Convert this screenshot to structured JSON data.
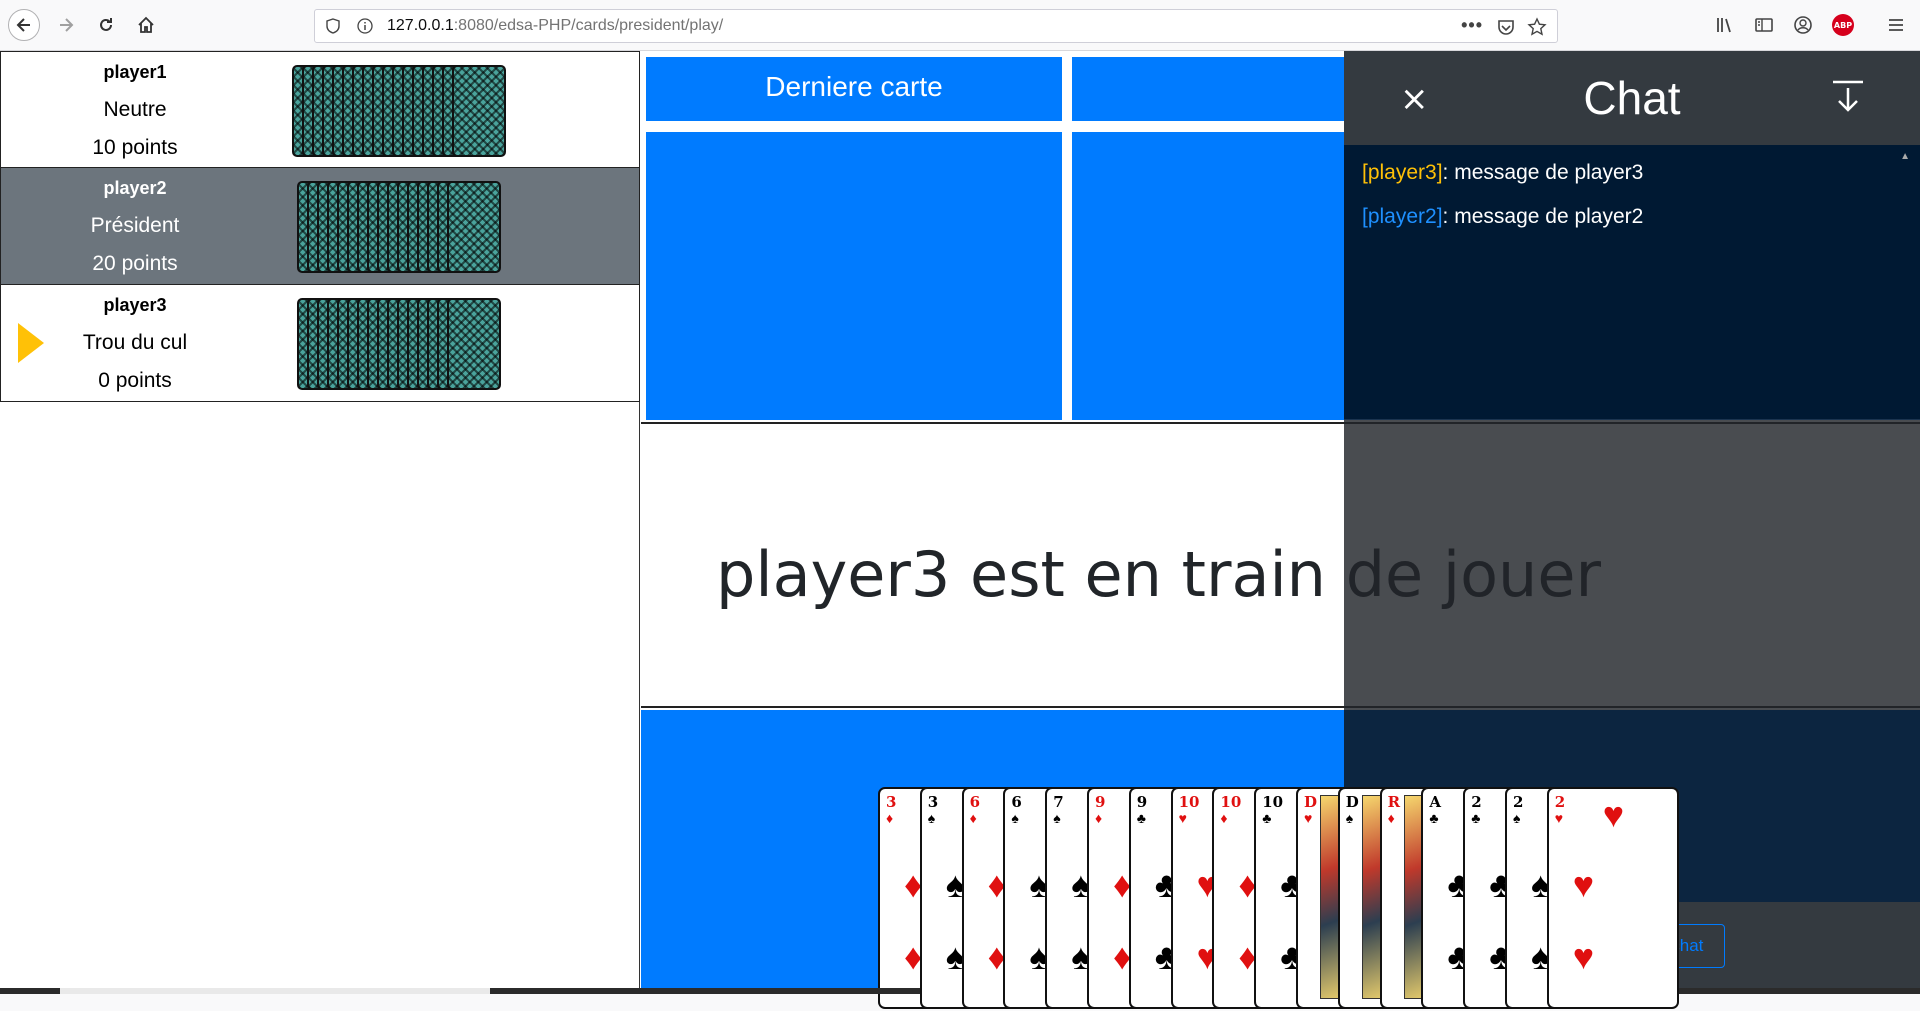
{
  "browser": {
    "url_host": "127.0.0.1",
    "url_rest": ":8080/edsa-PHP/cards/president/play/"
  },
  "players": [
    {
      "name": "player1",
      "rank": "Neutre",
      "points": "10 points",
      "cards": 17,
      "current": false,
      "highlight": false
    },
    {
      "name": "player2",
      "rank": "Président",
      "points": "20 points",
      "cards": 16,
      "current": false,
      "highlight": true
    },
    {
      "name": "player3",
      "rank": "Trou du cul",
      "points": "0 points",
      "cards": 16,
      "current": true,
      "highlight": false
    }
  ],
  "board": {
    "last_card_label": "Derniere carte",
    "status": "player3 est en train de jouer"
  },
  "hand": [
    {
      "rank": "3",
      "suit": "♦",
      "color": "red"
    },
    {
      "rank": "3",
      "suit": "♠",
      "color": "black"
    },
    {
      "rank": "6",
      "suit": "♦",
      "color": "red"
    },
    {
      "rank": "6",
      "suit": "♠",
      "color": "black"
    },
    {
      "rank": "7",
      "suit": "♠",
      "color": "black"
    },
    {
      "rank": "9",
      "suit": "♦",
      "color": "red"
    },
    {
      "rank": "9",
      "suit": "♣",
      "color": "black"
    },
    {
      "rank": "10",
      "suit": "♥",
      "color": "red"
    },
    {
      "rank": "10",
      "suit": "♦",
      "color": "red"
    },
    {
      "rank": "10",
      "suit": "♣",
      "color": "black"
    },
    {
      "rank": "D",
      "suit": "♥",
      "color": "red"
    },
    {
      "rank": "D",
      "suit": "♠",
      "color": "black"
    },
    {
      "rank": "R",
      "suit": "♦",
      "color": "red"
    },
    {
      "rank": "A",
      "suit": "♣",
      "color": "black"
    },
    {
      "rank": "2",
      "suit": "♣",
      "color": "black"
    },
    {
      "rank": "2",
      "suit": "♠",
      "color": "black"
    },
    {
      "rank": "2",
      "suit": "♥",
      "color": "red"
    }
  ],
  "chat": {
    "title": "Chat",
    "close_icon": "×",
    "messages": [
      {
        "author": "[player3]",
        "text": ": message de player3",
        "color": "#ffc107"
      },
      {
        "author": "[player2]",
        "text": ": message de player2",
        "color": "#1e90ff"
      }
    ],
    "write_button": "Ecrire dans le chat"
  }
}
